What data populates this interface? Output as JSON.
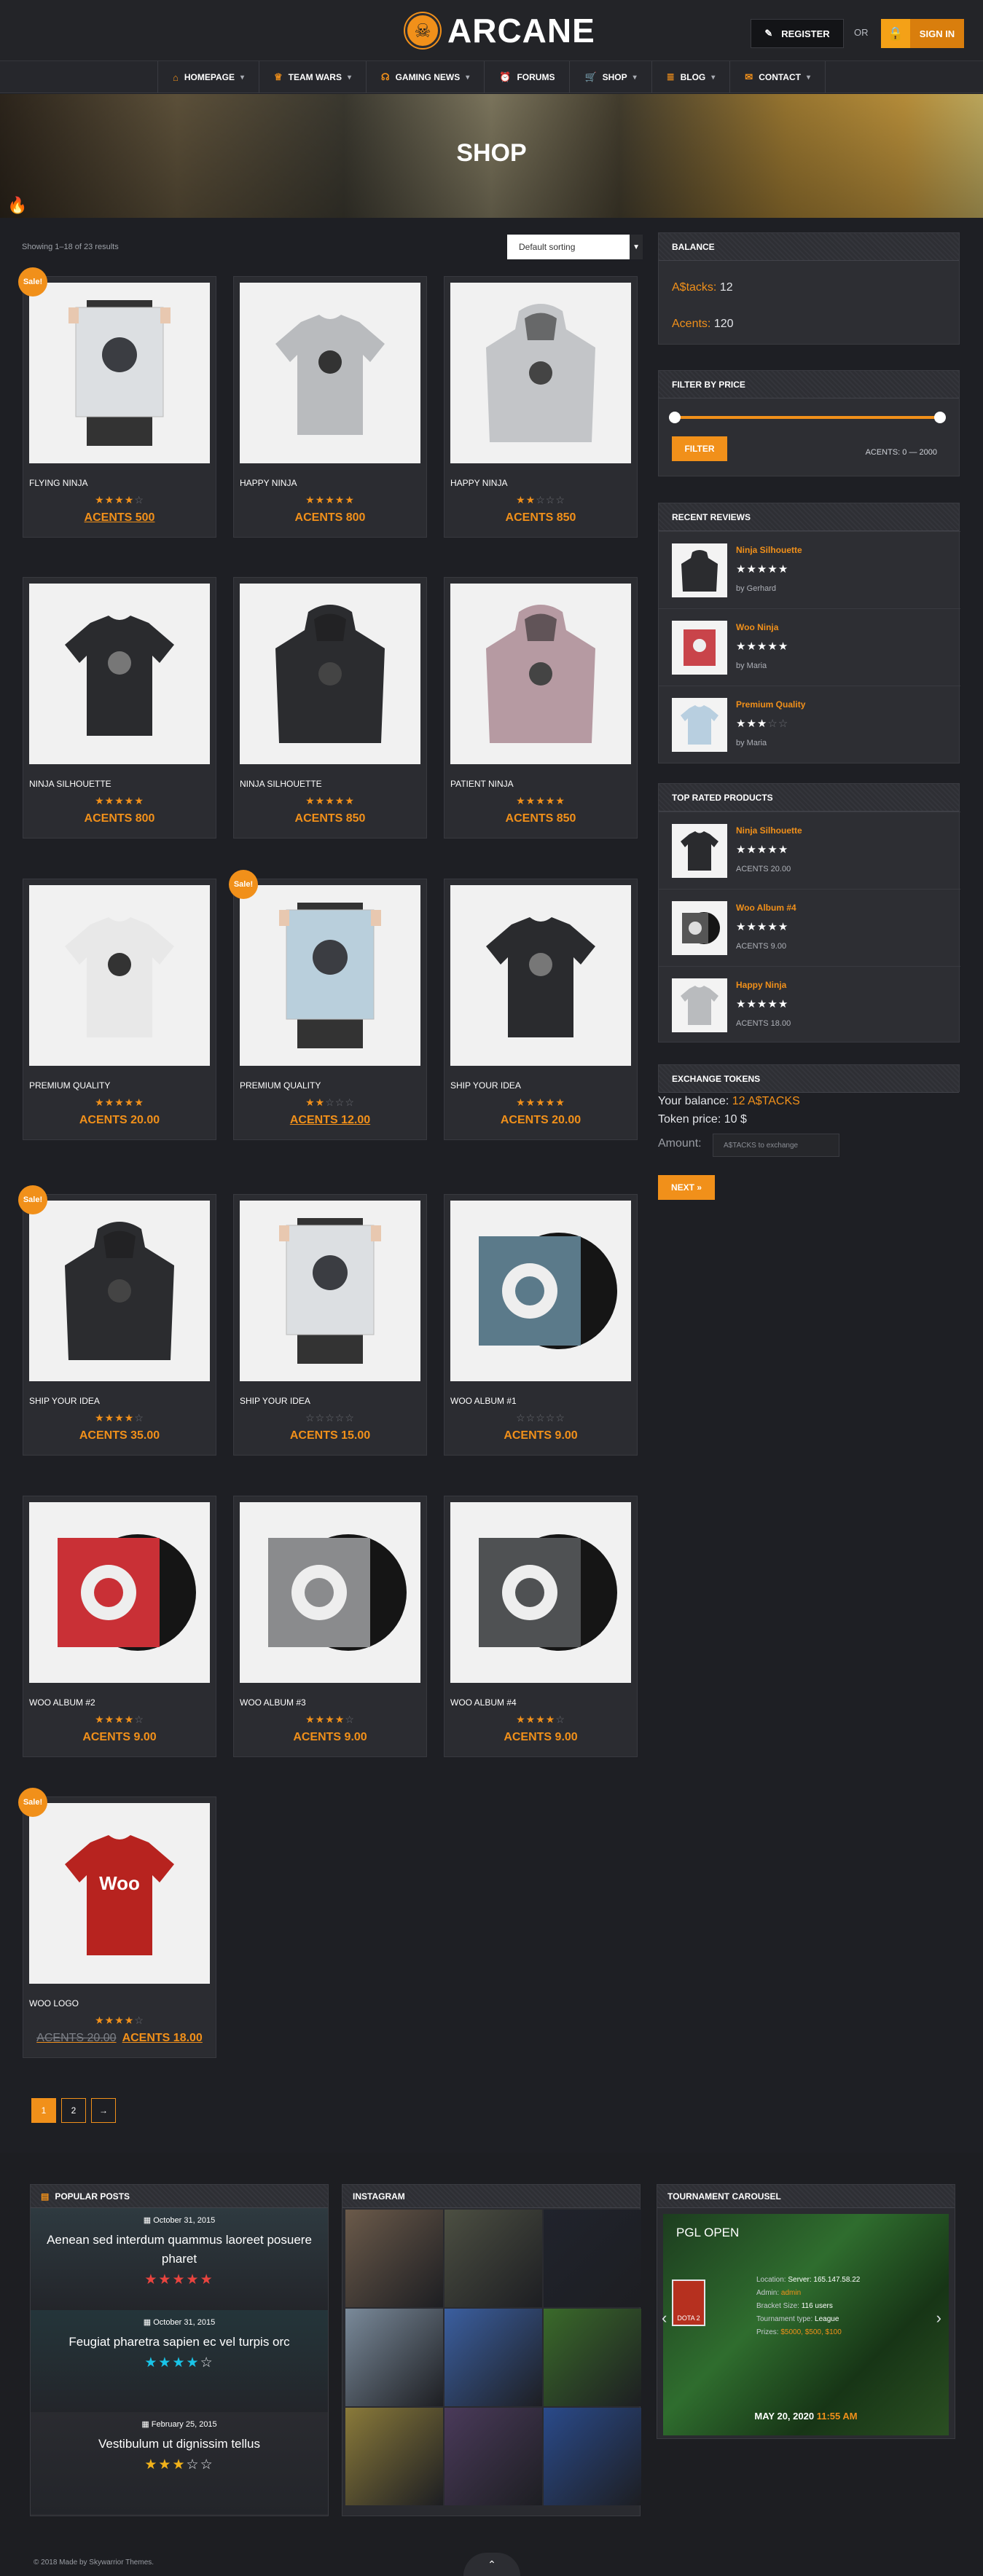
{
  "brand": {
    "name": "ARCANE",
    "accent": "#f1901a"
  },
  "header": {
    "register": "REGISTER",
    "or": "OR",
    "signin": "SIGN IN"
  },
  "nav": [
    {
      "label": "HOMEPAGE",
      "icon": "home-icon",
      "dropdown": true
    },
    {
      "label": "TEAM WARS",
      "icon": "trophy-icon",
      "dropdown": true
    },
    {
      "label": "GAMING NEWS",
      "icon": "headset-icon",
      "dropdown": true
    },
    {
      "label": "FORUMS",
      "icon": "alarm-icon",
      "dropdown": false
    },
    {
      "label": "SHOP",
      "icon": "cart-icon",
      "dropdown": true
    },
    {
      "label": "BLOG",
      "icon": "list-icon",
      "dropdown": true
    },
    {
      "label": "CONTACT",
      "icon": "mail-icon",
      "dropdown": true
    }
  ],
  "hero": {
    "title": "SHOP"
  },
  "shop": {
    "result_count": "Showing 1–18 of 23 results",
    "sort": "Default sorting"
  },
  "products": [
    {
      "name": "FLYING NINJA",
      "rating": 4,
      "price": "ACENTS 500",
      "sale": true,
      "underline": true,
      "img": "poster"
    },
    {
      "name": "HAPPY NINJA",
      "rating": 5,
      "price": "ACENTS 800",
      "sale": false,
      "img": "tee-grey"
    },
    {
      "name": "HAPPY NINJA",
      "rating": 2,
      "price": "ACENTS 850",
      "sale": false,
      "img": "hoodie-grey"
    },
    {
      "name": "NINJA SILHOUETTE",
      "rating": 5,
      "price": "ACENTS 800",
      "sale": false,
      "img": "tee-black"
    },
    {
      "name": "NINJA SILHOUETTE",
      "rating": 5,
      "price": "ACENTS 850",
      "sale": false,
      "img": "hoodie-black"
    },
    {
      "name": "PATIENT NINJA",
      "rating": 5,
      "price": "ACENTS 850",
      "sale": false,
      "img": "hoodie-pink"
    },
    {
      "name": "PREMIUM QUALITY",
      "rating": 5,
      "price": "ACENTS 20.00",
      "sale": false,
      "img": "tee-white"
    },
    {
      "name": "PREMIUM QUALITY",
      "rating": 2,
      "price": "ACENTS 12.00",
      "sale": true,
      "underline": true,
      "img": "poster-blue"
    },
    {
      "name": "SHIP YOUR IDEA",
      "rating": 5,
      "price": "ACENTS 20.00",
      "sale": false,
      "img": "tee-black"
    },
    {
      "name": "SHIP YOUR IDEA",
      "rating": 4,
      "price": "ACENTS 35.00",
      "sale": true,
      "img": "hoodie-black"
    },
    {
      "name": "SHIP YOUR IDEA",
      "rating": 0,
      "price": "ACENTS 15.00",
      "sale": false,
      "img": "poster"
    },
    {
      "name": "WOO ALBUM #1",
      "rating": 0,
      "price": "ACENTS 9.00",
      "sale": false,
      "img": "album-blue"
    },
    {
      "name": "WOO ALBUM #2",
      "rating": 4,
      "price": "ACENTS 9.00",
      "sale": false,
      "img": "album-red"
    },
    {
      "name": "WOO ALBUM #3",
      "rating": 4,
      "price": "ACENTS 9.00",
      "sale": false,
      "img": "album-grey"
    },
    {
      "name": "WOO ALBUM #4",
      "rating": 4,
      "price": "ACENTS 9.00",
      "sale": false,
      "img": "album-dark"
    },
    {
      "name": "WOO LOGO",
      "rating": 4,
      "price": "ACENTS 18.00",
      "old_price": "ACENTS 20.00",
      "sale": true,
      "underline": true,
      "img": "tee-red"
    }
  ],
  "pagination": [
    "1",
    "2",
    "→"
  ],
  "sidebar": {
    "balance": {
      "title": "BALANCE",
      "stacks_label": "A$tacks:",
      "stacks_value": "12",
      "acents_label": "Acents:",
      "acents_value": "120"
    },
    "filter": {
      "title": "FILTER BY PRICE",
      "button": "FILTER",
      "range": "ACENTS: 0 — 2000"
    },
    "reviews": {
      "title": "RECENT REVIEWS",
      "items": [
        {
          "name": "Ninja Silhouette",
          "by": "by Gerhard",
          "rating": 5
        },
        {
          "name": "Woo Ninja",
          "by": "by Maria",
          "rating": 5
        },
        {
          "name": "Premium Quality",
          "by": "by Maria",
          "rating": 3
        }
      ]
    },
    "top": {
      "title": "TOP RATED PRODUCTS",
      "items": [
        {
          "name": "Ninja Silhouette",
          "price": "ACENTS 20.00",
          "rating": 5
        },
        {
          "name": "Woo Album #4",
          "price": "ACENTS 9.00",
          "rating": 5
        },
        {
          "name": "Happy Ninja",
          "price": "ACENTS 18.00",
          "rating": 5
        }
      ]
    },
    "exchange": {
      "title": "EXCHANGE TOKENS",
      "balance_label": "Your balance:",
      "balance_value": "12 A$TACKS",
      "price": "Token price: 10 $",
      "amount_label": "Amount:",
      "placeholder": "A$TACKS to exchange",
      "button": "NEXT »"
    }
  },
  "footer": {
    "popular": {
      "title": "POPULAR POSTS",
      "posts": [
        {
          "date": "October 31, 2015",
          "title": "Aenean sed interdum quammus laoreet posuere pharet",
          "rating": 5,
          "color": "#e8443f"
        },
        {
          "date": "October 31, 2015",
          "title": "Feugiat pharetra sapien ec vel turpis orc",
          "rating": 4,
          "color": "#19c4e8"
        },
        {
          "date": "February 25, 2015",
          "title": "Vestibulum ut dignissim tellus",
          "rating": 3,
          "color": "#f1b21a"
        }
      ]
    },
    "instagram": {
      "title": "INSTAGRAM"
    },
    "tournament": {
      "title": "TOURNAMENT CAROUSEL",
      "name": "PGL OPEN",
      "location_label": "Location:",
      "location": "Server: 165.147.58.22",
      "admin_label": "Admin:",
      "admin": "admin",
      "bracket_label": "Bracket Size:",
      "bracket": "116 users",
      "type_label": "Tournament type:",
      "type": "League",
      "prizes_label": "Prizes:",
      "prizes": "$5000, $500, $100",
      "date": "MAY 20, 2020",
      "time": "11:55 AM",
      "game": "DOTA 2"
    },
    "copyright": "© 2018 Made by Skywarrior Themes."
  }
}
